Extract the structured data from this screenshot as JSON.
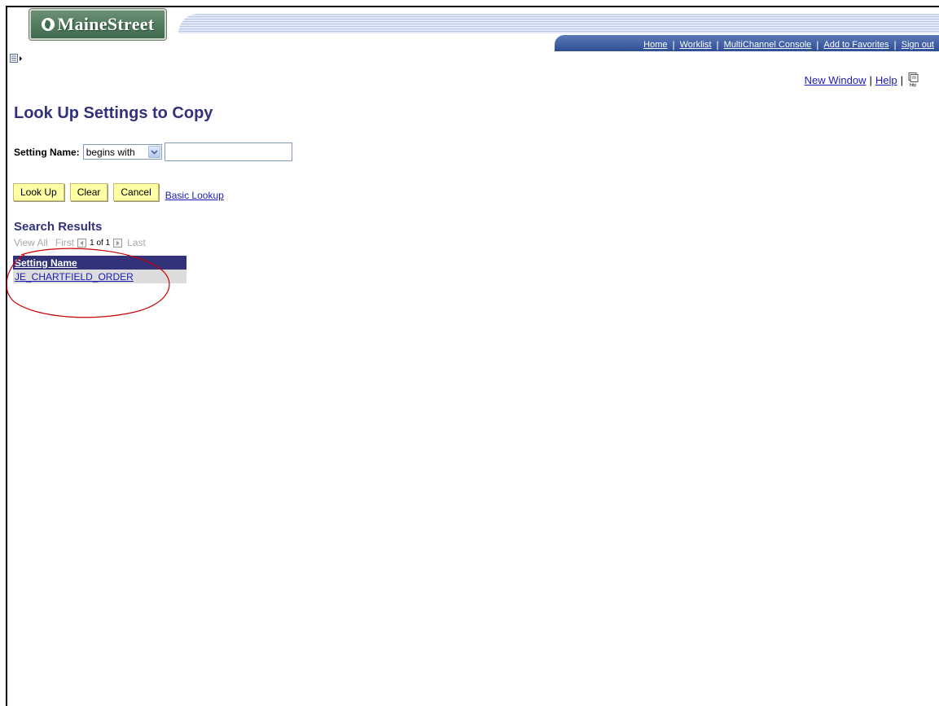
{
  "header": {
    "logo_text": "MaineStreet",
    "nav_links": [
      "Home",
      "Worklist",
      "MultiChannel Console",
      "Add to Favorites",
      "Sign out"
    ]
  },
  "toolbar": {
    "new_window": "New Window",
    "help": "Help",
    "http_icon_label": "http"
  },
  "page": {
    "title": "Look Up Settings to Copy"
  },
  "search": {
    "label": "Setting Name:",
    "operator": "begins with",
    "value": ""
  },
  "buttons": {
    "lookup": "Look Up",
    "clear": "Clear",
    "cancel": "Cancel",
    "basic_lookup": "Basic Lookup"
  },
  "results": {
    "title": "Search Results",
    "view_all": "View All",
    "first": "First",
    "count": "1 of 1",
    "last": "Last",
    "columns": [
      "Setting Name"
    ],
    "rows": [
      [
        "JE_CHARTFIELD_ORDER"
      ]
    ]
  },
  "colors": {
    "title": "#32327a",
    "link": "#1c1cb4",
    "button_bg": "#ffffa5",
    "nav_bar": "#2f4f95",
    "annotation": "#cc0000"
  }
}
